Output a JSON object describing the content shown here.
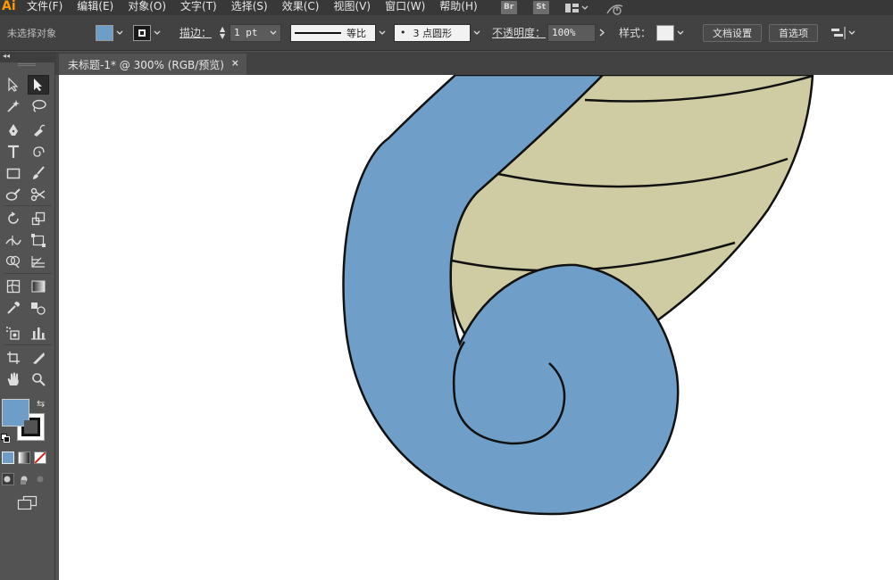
{
  "app": {
    "logo": "Ai"
  },
  "menu": {
    "items": [
      "文件(F)",
      "编辑(E)",
      "对象(O)",
      "文字(T)",
      "选择(S)",
      "效果(C)",
      "视图(V)",
      "窗口(W)",
      "帮助(H)"
    ],
    "bridge": "Br",
    "stock": "St"
  },
  "control": {
    "no_selection": "未选择对象",
    "fill_color": "#6e9dc8",
    "stroke_label": "描边：",
    "stroke_weight": "1 pt",
    "profile": "等比",
    "brush": "3 点圆形",
    "opacity_label": "不透明度：",
    "opacity_value": "100%",
    "style_label": "样式：",
    "doc_setup": "文档设置",
    "preferences": "首选项"
  },
  "document": {
    "tab_title": "未标题-1* @ 300% (RGB/预览)",
    "close": "×"
  },
  "artwork": {
    "blue": "#6f9fc8",
    "tan": "#cfcca3",
    "outline": "#111111"
  }
}
